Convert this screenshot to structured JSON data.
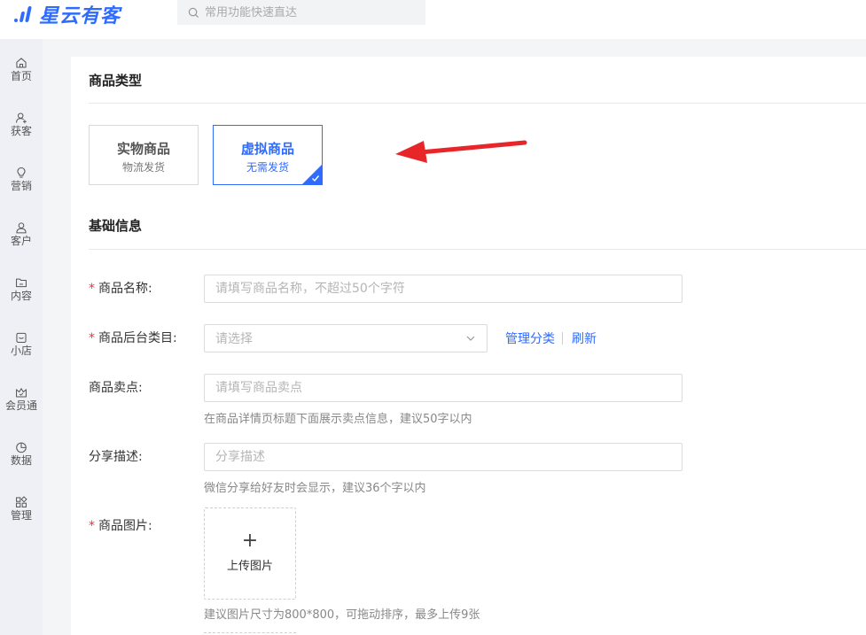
{
  "app": {
    "logo_text": "星云有客",
    "search_placeholder": "常用功能快速直达"
  },
  "sidebar": {
    "items": [
      {
        "label": "首页",
        "icon": "home-icon"
      },
      {
        "label": "获客",
        "icon": "user-add-icon"
      },
      {
        "label": "营销",
        "icon": "lightbulb-icon"
      },
      {
        "label": "客户",
        "icon": "user-icon"
      },
      {
        "label": "内容",
        "icon": "folder-icon"
      },
      {
        "label": "小店",
        "icon": "shop-icon"
      },
      {
        "label": "会员通",
        "icon": "crown-icon"
      },
      {
        "label": "数据",
        "icon": "pie-chart-icon"
      },
      {
        "label": "管理",
        "icon": "apps-icon"
      }
    ]
  },
  "product_type": {
    "title": "商品类型",
    "options": [
      {
        "name": "实物商品",
        "desc": "物流发货",
        "selected": false
      },
      {
        "name": "虚拟商品",
        "desc": "无需发货",
        "selected": true
      }
    ]
  },
  "basic_info": {
    "title": "基础信息",
    "fields": {
      "name": {
        "label": "商品名称:",
        "required": true,
        "placeholder": "请填写商品名称，不超过50个字符"
      },
      "category": {
        "label": "商品后台类目:",
        "required": true,
        "placeholder": "请选择",
        "manage_link": "管理分类",
        "refresh_link": "刷新"
      },
      "selling_point": {
        "label": "商品卖点:",
        "required": false,
        "placeholder": "请填写商品卖点",
        "hint": "在商品详情页标题下面展示卖点信息，建议50字以内"
      },
      "share_desc": {
        "label": "分享描述:",
        "required": false,
        "placeholder": "分享描述",
        "hint": "微信分享给好友时会显示，建议36个字以内"
      },
      "images": {
        "label": "商品图片:",
        "required": true,
        "upload_label": "上传图片",
        "hint": "建议图片尺寸为800*800，可拖动排序，最多上传9张"
      }
    }
  },
  "colors": {
    "accent": "#2f6bff",
    "required": "#e33333",
    "arrow": "#e8262a"
  }
}
